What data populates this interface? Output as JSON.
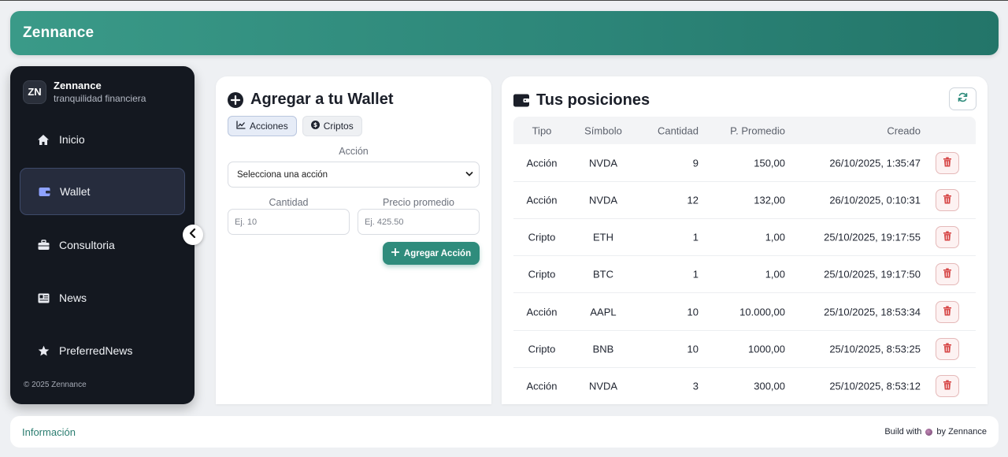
{
  "topbar": {
    "brand": "Zennance"
  },
  "sidebar": {
    "avatar": "ZN",
    "name": "Zennance",
    "tagline": "tranquilidad financiera",
    "items": [
      {
        "label": "Inicio",
        "icon": "home-icon",
        "active": false
      },
      {
        "label": "Wallet",
        "icon": "wallet-icon",
        "active": true
      },
      {
        "label": "Consultoria",
        "icon": "briefcase-icon",
        "active": false
      },
      {
        "label": "News",
        "icon": "newspaper-icon",
        "active": false
      },
      {
        "label": "PreferredNews",
        "icon": "star-icon",
        "active": false
      }
    ],
    "footer": "© 2025 Zennance"
  },
  "add_form": {
    "title": "Agregar a tu Wallet",
    "tabs": [
      {
        "label": "Acciones",
        "icon": "chart-line-icon",
        "active": true
      },
      {
        "label": "Criptos",
        "icon": "coin-icon",
        "active": false
      }
    ],
    "accion_label": "Acción",
    "select_value": "Selecciona una acción",
    "cantidad_label": "Cantidad",
    "cantidad_placeholder": "Ej. 10",
    "precio_label": "Precio promedio",
    "precio_placeholder": "Ej. 425.50",
    "submit_label": "Agregar Acción"
  },
  "positions": {
    "title": "Tus posiciones",
    "columns": [
      "Tipo",
      "Símbolo",
      "Cantidad",
      "P. Promedio",
      "Creado"
    ],
    "rows": [
      {
        "tipo": "Acción",
        "simbolo": "NVDA",
        "cantidad": "9",
        "promedio": "150,00",
        "creado": "26/10/2025, 1:35:47"
      },
      {
        "tipo": "Acción",
        "simbolo": "NVDA",
        "cantidad": "12",
        "promedio": "132,00",
        "creado": "26/10/2025, 0:10:31"
      },
      {
        "tipo": "Cripto",
        "simbolo": "ETH",
        "cantidad": "1",
        "promedio": "1,00",
        "creado": "25/10/2025, 19:17:55"
      },
      {
        "tipo": "Cripto",
        "simbolo": "BTC",
        "cantidad": "1",
        "promedio": "1,00",
        "creado": "25/10/2025, 19:17:50"
      },
      {
        "tipo": "Acción",
        "simbolo": "AAPL",
        "cantidad": "10",
        "promedio": "10.000,00",
        "creado": "25/10/2025, 18:53:34"
      },
      {
        "tipo": "Cripto",
        "simbolo": "BNB",
        "cantidad": "10",
        "promedio": "1000,00",
        "creado": "25/10/2025, 8:53:25"
      },
      {
        "tipo": "Acción",
        "simbolo": "NVDA",
        "cantidad": "3",
        "promedio": "300,00",
        "creado": "25/10/2025, 8:53:12"
      }
    ]
  },
  "footer": {
    "info": "Información",
    "build_prefix": "Build with",
    "build_suffix": "by Zennance"
  },
  "colors": {
    "accent": "#2f8c7c",
    "sidebar_bg": "#141820",
    "danger": "#d64545"
  }
}
